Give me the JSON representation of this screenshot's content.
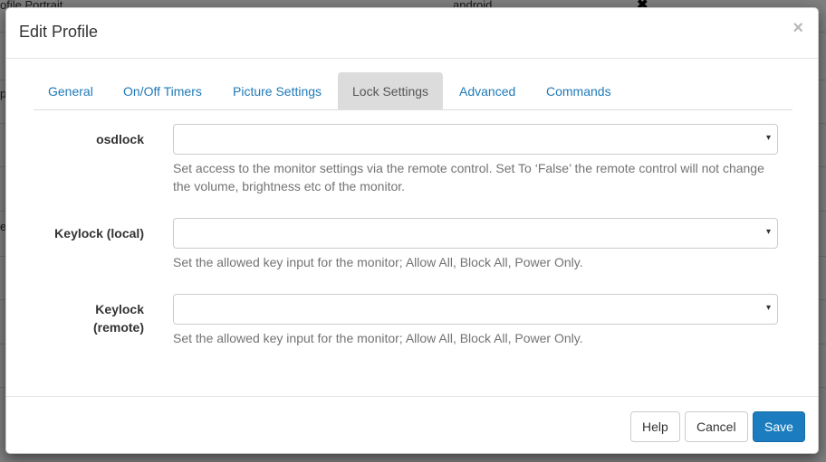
{
  "background": {
    "row_title": "ofile Portrait",
    "row_platform": "android",
    "row_close": "✖",
    "left_fragment_1": "p",
    "left_fragment_2": "e"
  },
  "modal": {
    "title": "Edit Profile",
    "close_glyph": "×"
  },
  "tabs": [
    {
      "label": "General",
      "active": false
    },
    {
      "label": "On/Off Timers",
      "active": false
    },
    {
      "label": "Picture Settings",
      "active": false
    },
    {
      "label": "Lock Settings",
      "active": true
    },
    {
      "label": "Advanced",
      "active": false
    },
    {
      "label": "Commands",
      "active": false
    }
  ],
  "fields": {
    "osdlock": {
      "label": "osdlock",
      "value": "",
      "help": "Set access to the monitor settings via the remote control. Set To ‘False’ the remote control will not change the volume, brightness etc of the monitor."
    },
    "keylock_local": {
      "label": "Keylock (local)",
      "value": "",
      "help": "Set the allowed key input for the monitor; Allow All, Block All, Power Only."
    },
    "keylock_remote": {
      "label_line1": "Keylock",
      "label_line2": "(remote)",
      "value": "",
      "help": "Set the allowed key input for the monitor; Allow All, Block All, Power Only."
    }
  },
  "icons": {
    "select_caret": "▾"
  },
  "footer": {
    "help_label": "Help",
    "cancel_label": "Cancel",
    "save_label": "Save"
  },
  "colors": {
    "link": "#1f7ab8",
    "primary": "#1b7dbf",
    "active_tab_bg": "#dcdcdc"
  }
}
